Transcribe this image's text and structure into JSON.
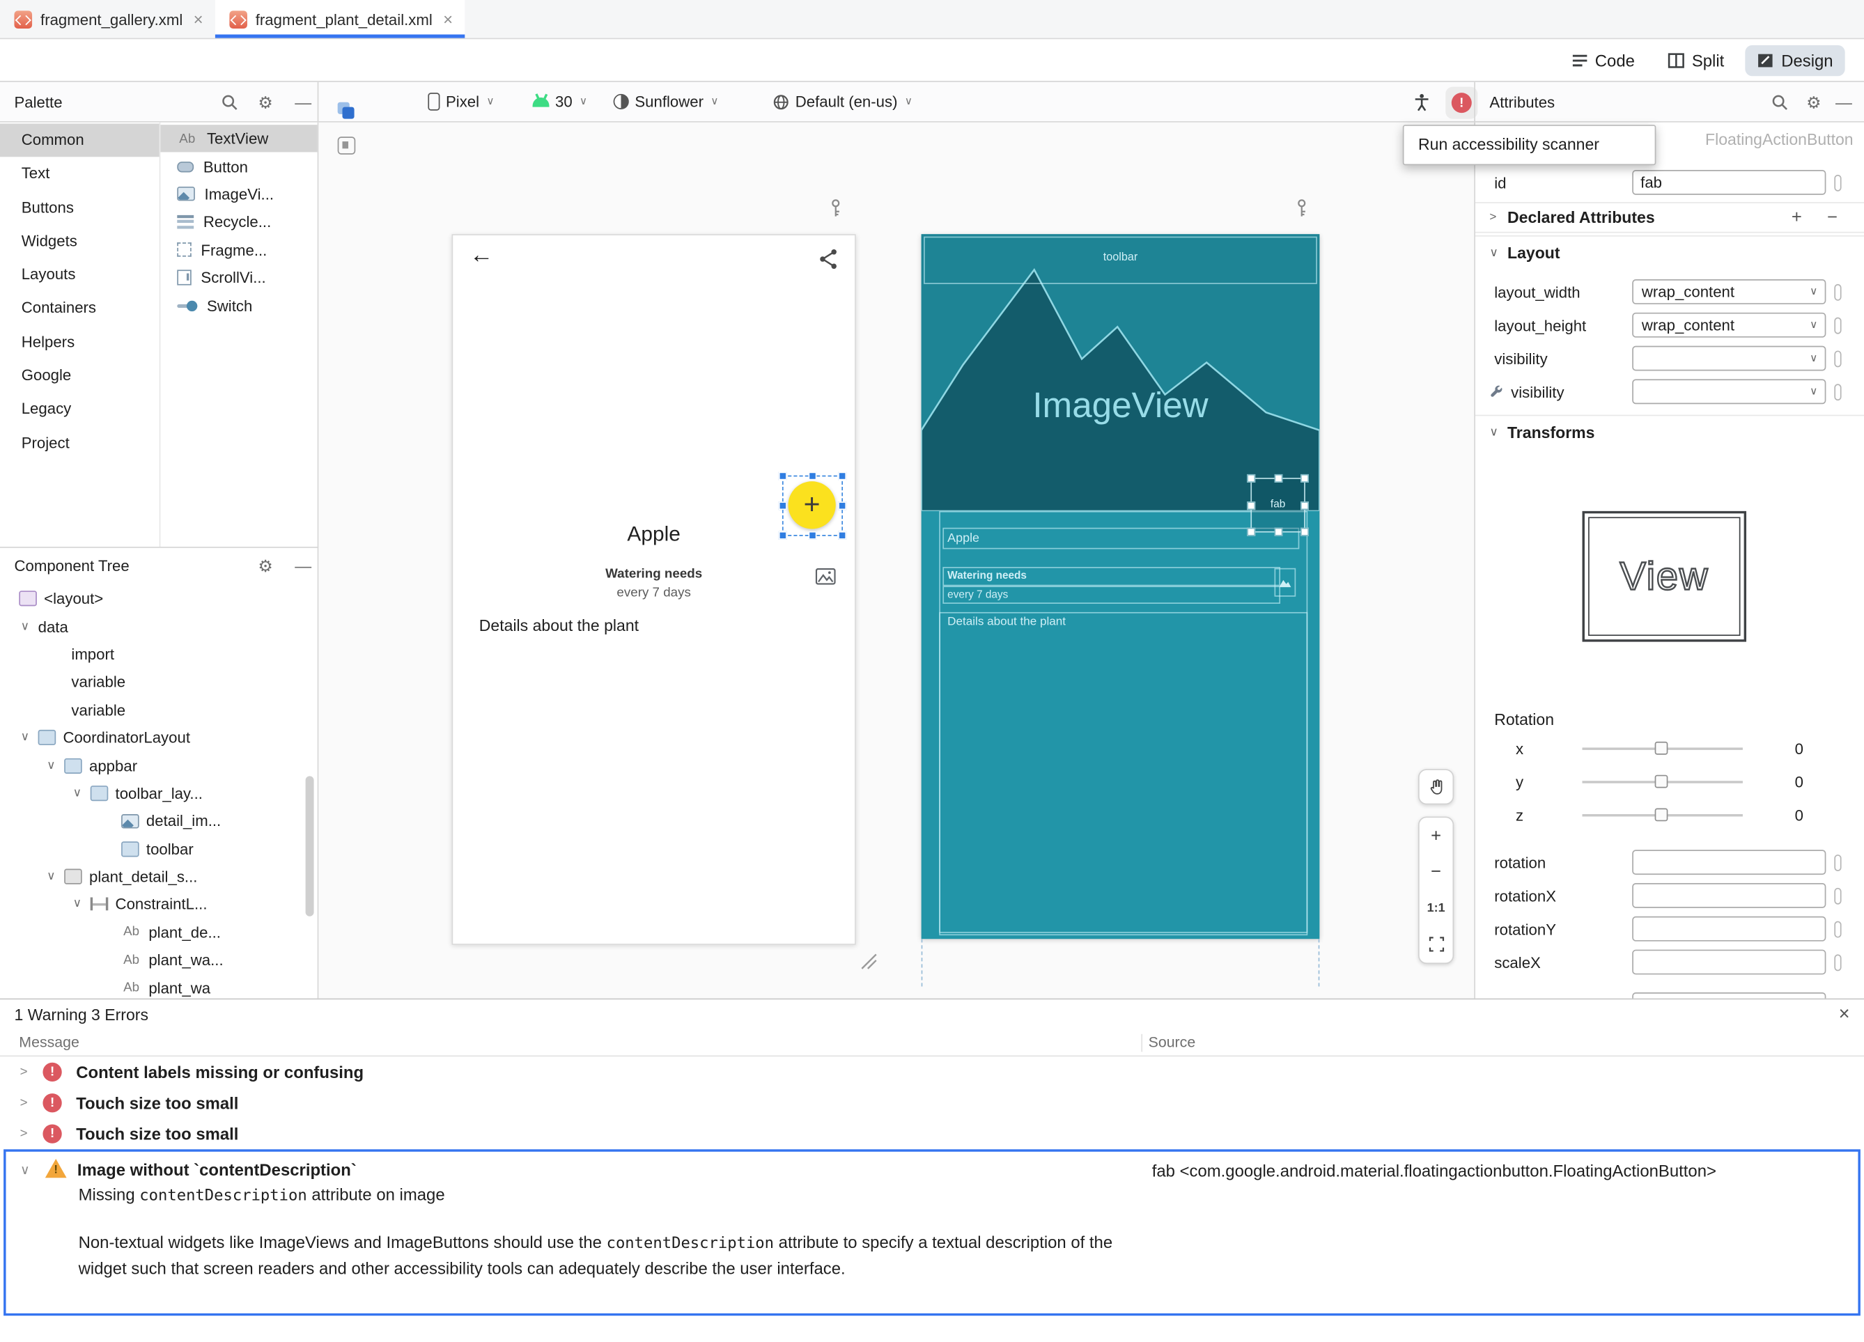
{
  "icons": {
    "close": "×",
    "gear": "⚙",
    "minimize": "—",
    "chevron_down": "∨",
    "chevron_collapsed": ">",
    "dropdown": "∨",
    "back_arrow": "←",
    "plus": "+",
    "minus": "−",
    "exclamation": "!",
    "ab": "Ab"
  },
  "tabs": [
    {
      "label": "fragment_gallery.xml"
    },
    {
      "label": "fragment_plant_detail.xml"
    }
  ],
  "view_switcher": {
    "code": "Code",
    "split": "Split",
    "design": "Design"
  },
  "design_toolbar": {
    "device": "Pixel",
    "api_level": "30",
    "theme": "Sunflower",
    "locale": "Default (en-us)"
  },
  "tooltip": {
    "text": "Run accessibility scanner"
  },
  "palette": {
    "title": "Palette",
    "categories": [
      "Common",
      "Text",
      "Buttons",
      "Widgets",
      "Layouts",
      "Containers",
      "Helpers",
      "Google",
      "Legacy",
      "Project"
    ],
    "components": [
      {
        "label": "TextView"
      },
      {
        "label": "Button"
      },
      {
        "label": "ImageVi..."
      },
      {
        "label": "Recycle..."
      },
      {
        "label": "Fragme..."
      },
      {
        "label": "ScrollVi..."
      },
      {
        "label": "Switch"
      }
    ]
  },
  "component_tree": {
    "title": "Component Tree",
    "items": [
      {
        "label": "<layout>"
      },
      {
        "label": "data"
      },
      {
        "label": "import"
      },
      {
        "label": "variable"
      },
      {
        "label": "variable"
      },
      {
        "label": "CoordinatorLayout"
      },
      {
        "label": "appbar"
      },
      {
        "label": "toolbar_lay..."
      },
      {
        "label": "detail_im..."
      },
      {
        "label": "toolbar"
      },
      {
        "label": "plant_detail_s..."
      },
      {
        "label": "ConstraintL..."
      },
      {
        "label": "plant_de..."
      },
      {
        "label": "plant_wa..."
      },
      {
        "label": "plant_wa"
      }
    ]
  },
  "design_preview": {
    "plant_name": "Apple",
    "watering_label": "Watering needs",
    "watering_value": "every 7 days",
    "details": "Details about the plant"
  },
  "blueprint_preview": {
    "toolbar_label": "toolbar",
    "imageview_label": "ImageView",
    "plant_name": "Apple",
    "watering_label": "Watering needs",
    "watering_value": "every 7 days",
    "details": "Details about the plant",
    "fab_label": "fab"
  },
  "zoom_controls": {
    "one_to_one": "1:1"
  },
  "attributes": {
    "title": "Attributes",
    "component_type": "FloatingActionButton",
    "id_label": "id",
    "id_value": "fab",
    "sections": {
      "declared": "Declared Attributes",
      "layout": "Layout",
      "transforms": "Transforms"
    },
    "fields": [
      {
        "label": "layout_width",
        "value": "wrap_content"
      },
      {
        "label": "layout_height",
        "value": "wrap_content"
      },
      {
        "label": "visibility",
        "value": ""
      },
      {
        "label": "visibility",
        "value": ""
      }
    ],
    "view_preview_label": "View",
    "rotation": {
      "title": "Rotation",
      "sliders": [
        {
          "axis": "x",
          "value": "0"
        },
        {
          "axis": "y",
          "value": "0"
        },
        {
          "axis": "z",
          "value": "0"
        }
      ]
    },
    "transform_fields": [
      {
        "label": "rotation"
      },
      {
        "label": "rotationX"
      },
      {
        "label": "rotationY"
      },
      {
        "label": "scaleX"
      }
    ]
  },
  "problems": {
    "summary": "1 Warning 3 Errors",
    "columns": {
      "message": "Message",
      "source": "Source"
    },
    "rows": [
      {
        "message": "Content labels missing or confusing"
      },
      {
        "message": "Touch size too small"
      },
      {
        "message": "Touch size too small"
      }
    ],
    "selected": {
      "message": "Image without `contentDescription`",
      "source": "fab <com.google.android.material.floatingactionbutton.FloatingActionButton>",
      "detail_pre": "Missing ",
      "detail_code": "contentDescription",
      "detail_post": " attribute on image",
      "body_pre": "Non-textual widgets like ImageViews and ImageButtons should use the ",
      "body_code": "contentDescription",
      "body_post": " attribute to specify a textual description of the widget such that screen readers and other accessibility tools can adequately describe the user interface."
    }
  }
}
